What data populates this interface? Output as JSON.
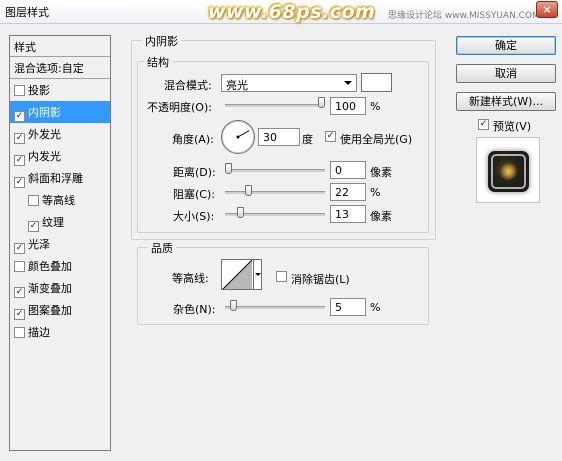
{
  "window": {
    "title": "图层样式",
    "logo_text": "www.68ps.com",
    "watermark": "思缘设计论坛 www.MISSYUAN.COM",
    "close_label": "×"
  },
  "style_list": {
    "header": "样式",
    "blend_options": "混合选项:自定",
    "items": [
      {
        "label": "投影",
        "checked": false,
        "check": ""
      },
      {
        "label": "内阴影",
        "checked": true,
        "check": "✓",
        "selected": true
      },
      {
        "label": "外发光",
        "checked": true,
        "check": "✓"
      },
      {
        "label": "内发光",
        "checked": true,
        "check": "✓"
      },
      {
        "label": "斜面和浮雕",
        "checked": true,
        "check": "✓"
      },
      {
        "label": "等高线",
        "checked": false,
        "check": "",
        "sub": true
      },
      {
        "label": "纹理",
        "checked": true,
        "check": "✓",
        "sub": true
      },
      {
        "label": "光泽",
        "checked": true,
        "check": "✓"
      },
      {
        "label": "颜色叠加",
        "checked": false,
        "check": ""
      },
      {
        "label": "渐变叠加",
        "checked": true,
        "check": "✓"
      },
      {
        "label": "图案叠加",
        "checked": true,
        "check": "✓"
      },
      {
        "label": "描边",
        "checked": false,
        "check": ""
      }
    ]
  },
  "inner_shadow": {
    "section_title": "内阴影",
    "structure": {
      "title": "结构",
      "blend_mode_label": "混合模式:",
      "blend_mode_value": "亮光",
      "swatch_color": "#ffffff",
      "opacity_label": "不透明度(O):",
      "opacity_value": "100",
      "opacity_unit": "%",
      "opacity_fraction": 1.0,
      "angle_label": "角度(A):",
      "angle_value": "30",
      "angle_unit": "度",
      "use_global_light_label": "使用全局光(G)",
      "use_global_light_checked": true,
      "use_global_light_check": "✓",
      "distance_label": "距离(D):",
      "distance_value": "0",
      "distance_unit": "像素",
      "distance_fraction": 0.0,
      "choke_label": "阻塞(C):",
      "choke_value": "22",
      "choke_unit": "%",
      "choke_fraction": 0.22,
      "size_label": "大小(S):",
      "size_value": "13",
      "size_unit": "像素",
      "size_fraction": 0.13
    },
    "quality": {
      "title": "品质",
      "contour_label": "等高线:",
      "anti_alias_label": "消除锯齿(L)",
      "anti_alias_checked": false,
      "anti_alias_check": "",
      "noise_label": "杂色(N):",
      "noise_value": "5",
      "noise_unit": "%",
      "noise_fraction": 0.05
    }
  },
  "buttons": {
    "ok": "确定",
    "cancel": "取消",
    "new_style": "新建样式(W)...",
    "preview_label": "预览(V)",
    "preview_checked": true,
    "preview_check": "✓"
  }
}
